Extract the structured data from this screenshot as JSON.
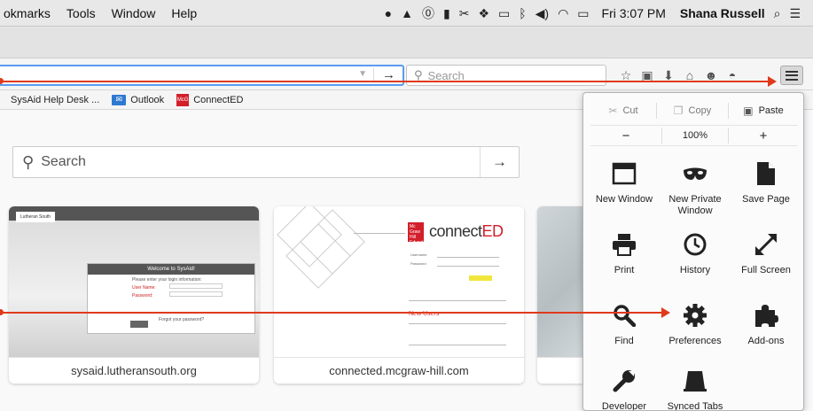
{
  "menubar": {
    "items": [
      "okmarks",
      "Tools",
      "Window",
      "Help"
    ],
    "clock": "Fri 3:07 PM",
    "user": "Shana Russell",
    "status_icons": [
      "evernote-icon",
      "drive-icon",
      "onepassword-icon",
      "app-icon",
      "scissors-icon",
      "dropbox-icon",
      "battery-meter-icon",
      "bluetooth-icon",
      "volume-icon",
      "wifi-icon",
      "battery-icon",
      "spotlight-icon",
      "notification-center-icon"
    ]
  },
  "navbar": {
    "url_value": "",
    "search_placeholder": "Search",
    "go_glyph": "→"
  },
  "bookmarks": {
    "items": [
      {
        "label": "SysAid Help Desk ..."
      },
      {
        "label": "Outlook"
      },
      {
        "label": "ConnectED"
      }
    ]
  },
  "newtab": {
    "search_placeholder": "Search",
    "tiles": [
      {
        "label": "sysaid.lutheransouth.org"
      },
      {
        "label": "connected.mcgraw-hill.com"
      },
      {
        "label": ""
      }
    ],
    "sysaid_thumb": {
      "logo": "Lutheran South",
      "header": "Welcome to SysAid!",
      "prompt": "Please enter your login information:",
      "user_label": "User Name:",
      "password_label": "Password:",
      "forgot": "Forgot your password?"
    },
    "connect_thumb": {
      "logo_text": "Mc Graw Hill Education",
      "word_main": "connect",
      "word_accent": "ED",
      "username_label": "Username",
      "password_label": "Password",
      "news": "New Users"
    }
  },
  "panel": {
    "cut": "Cut",
    "copy": "Copy",
    "paste": "Paste",
    "zoom_out": "−",
    "zoom_level": "100%",
    "zoom_in": "+",
    "items": [
      {
        "label": "New Window",
        "icon": "new-window-icon"
      },
      {
        "label": "New Private Window",
        "icon": "private-mask-icon"
      },
      {
        "label": "Save Page",
        "icon": "save-page-icon"
      },
      {
        "label": "Print",
        "icon": "printer-icon"
      },
      {
        "label": "History",
        "icon": "clock-icon"
      },
      {
        "label": "Full Screen",
        "icon": "fullscreen-icon"
      },
      {
        "label": "Find",
        "icon": "magnifier-icon"
      },
      {
        "label": "Preferences",
        "icon": "gear-icon"
      },
      {
        "label": "Add-ons",
        "icon": "puzzle-icon"
      },
      {
        "label": "Developer",
        "icon": "wrench-icon"
      },
      {
        "label": "Synced Tabs",
        "icon": "synced-tabs-icon"
      }
    ]
  },
  "colors": {
    "annotation_arrow": "#e03a1c",
    "url_focus": "#5a9cf0",
    "connect_red": "#d31f2a"
  }
}
